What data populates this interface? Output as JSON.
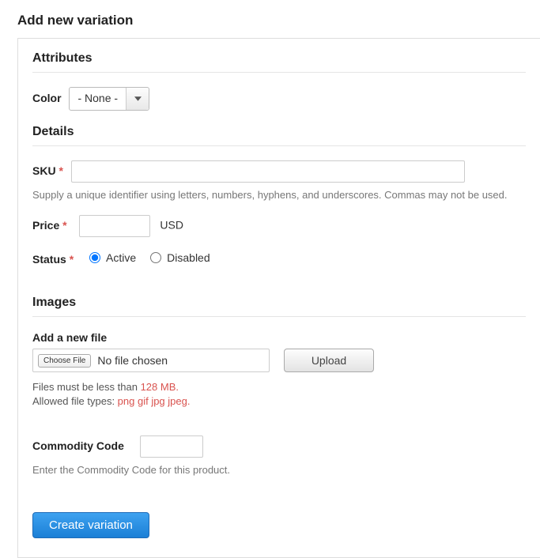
{
  "page": {
    "title": "Add new variation"
  },
  "sections": {
    "attributes": {
      "heading": "Attributes",
      "color": {
        "label": "Color",
        "value": "- None -"
      }
    },
    "details": {
      "heading": "Details",
      "sku": {
        "label": "SKU",
        "value": "",
        "help": "Supply a unique identifier using letters, numbers, hyphens, and underscores. Commas may not be used."
      },
      "price": {
        "label": "Price",
        "value": "",
        "currency": "USD"
      },
      "status": {
        "label": "Status",
        "options": {
          "active": "Active",
          "disabled": "Disabled"
        },
        "selected": "active"
      }
    },
    "images": {
      "heading": "Images",
      "add_label": "Add a new file",
      "choose_label": "Choose File",
      "no_file": "No file chosen",
      "upload_label": "Upload",
      "limit_prefix": "Files must be less than ",
      "limit_value": "128 MB.",
      "types_prefix": "Allowed file types: ",
      "types_value": "png gif jpg jpeg"
    },
    "commodity": {
      "label": "Commodity Code",
      "value": "",
      "help": "Enter the Commodity Code for this product."
    }
  },
  "actions": {
    "submit": "Create variation"
  },
  "required_marker": "*"
}
